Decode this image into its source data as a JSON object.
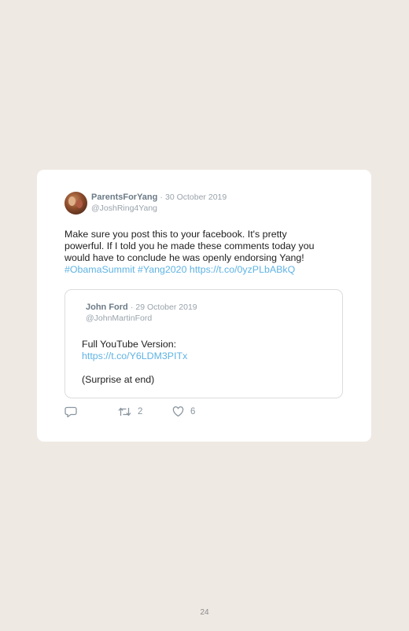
{
  "tweet": {
    "display_name": "ParentsForYang",
    "separator": "·",
    "date": "30 October 2019",
    "handle": "@JoshRing4Yang",
    "text_lines": [
      "Make sure you post this to your facebook. It's pretty",
      "powerful. If I told you he made these comments today you",
      "would have to conclude he was openly endorsing Yang!"
    ],
    "hashtag_1": "#ObamaSummit",
    "hashtag_2": "#Yang2020",
    "link": "https://t.co/0yzPLbABkQ"
  },
  "quoted_tweet": {
    "display_name": "John Ford",
    "separator": "·",
    "date": "29 October 2019",
    "handle": "@JohnMartinFord",
    "line_1": "Full YouTube Version:",
    "link": "https://t.co/Y6LDM3PITx",
    "line_3": "(Surprise at end)"
  },
  "actions": {
    "reply_icon": "reply-icon",
    "retweet_icon": "retweet-icon",
    "retweet_count": "2",
    "like_icon": "heart-icon",
    "like_count": "6"
  },
  "page_number": "24",
  "colors": {
    "background": "#efe9e3",
    "link": "#5fb3e4",
    "name": "#6b7a86",
    "muted": "#9aa3ab"
  }
}
